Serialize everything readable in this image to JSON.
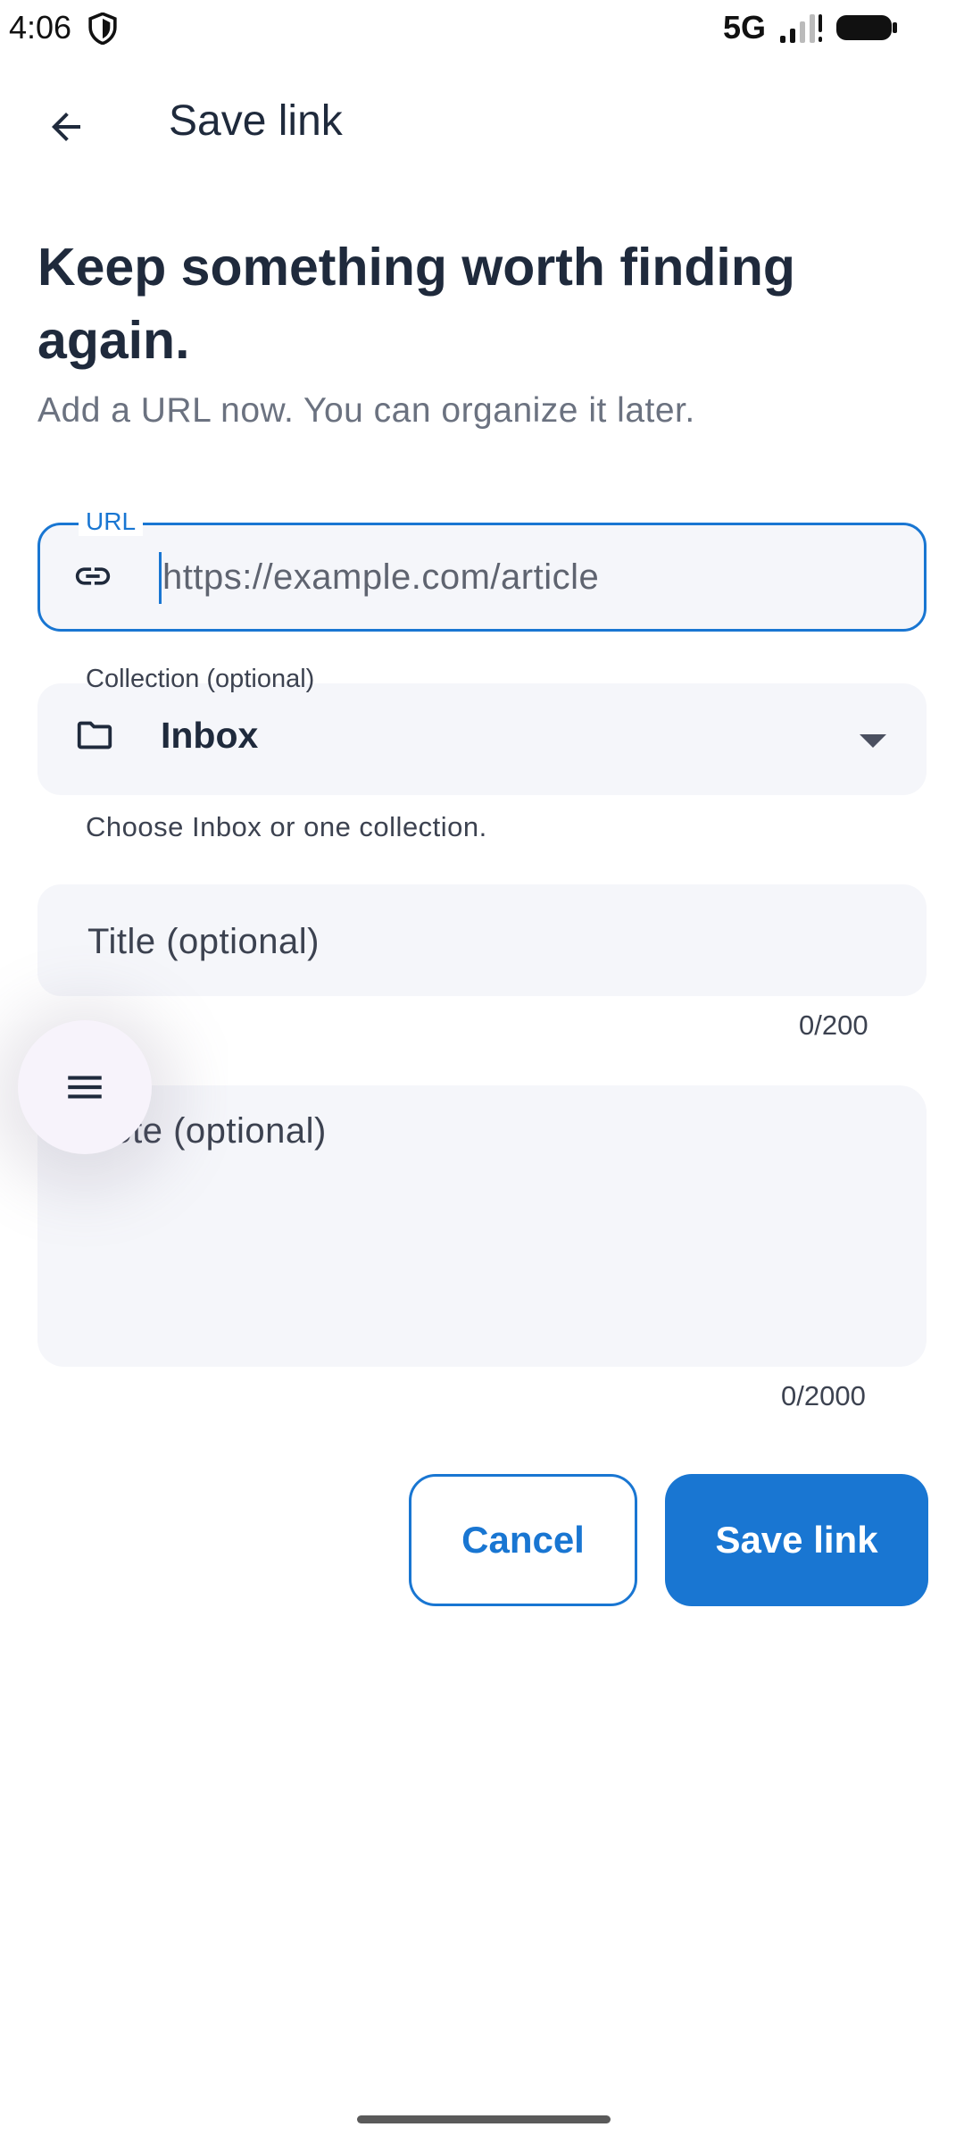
{
  "status_bar": {
    "time": "4:06",
    "network": "5G"
  },
  "app_bar": {
    "title": "Save link",
    "back_icon": "arrow-back-icon"
  },
  "content": {
    "headline": "Keep something worth finding again.",
    "subhead": "Add a URL now. You can organize it later."
  },
  "form": {
    "url": {
      "label": "URL",
      "placeholder": "https://example.com/article",
      "value": "",
      "icon": "link-icon"
    },
    "collection": {
      "label": "Collection (optional)",
      "value": "Inbox",
      "helper": "Choose Inbox or one collection.",
      "icon": "folder-icon"
    },
    "title": {
      "placeholder": "Title (optional)",
      "counter": "0/200"
    },
    "note": {
      "placeholder": "Note (optional)",
      "counter": "0/2000"
    }
  },
  "actions": {
    "cancel_label": "Cancel",
    "save_label": "Save link"
  },
  "colors": {
    "primary": "#1976d2",
    "field_bg": "#f5f6fa",
    "text_dark": "#1f2a3c"
  }
}
